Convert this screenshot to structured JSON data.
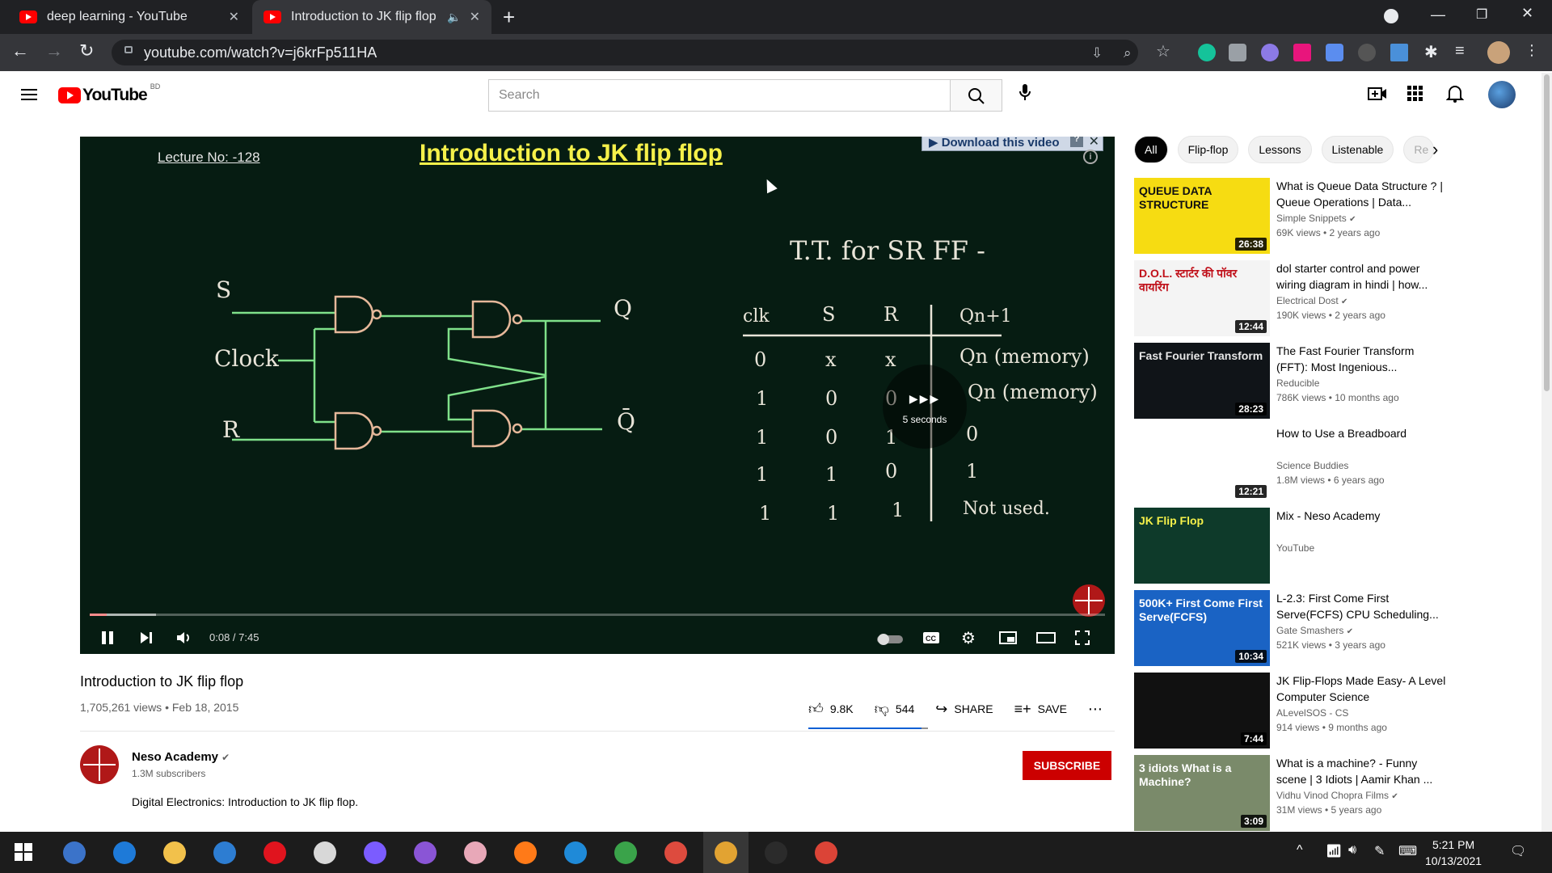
{
  "browser": {
    "tabs": [
      {
        "title": "deep learning - YouTube",
        "active": false
      },
      {
        "title": "Introduction to JK flip flop - Y",
        "active": true
      }
    ],
    "new_tab_symbol": "+",
    "url": "youtube.com/watch?v=j6krFp511HA"
  },
  "youtube": {
    "logo_text": "YouTube",
    "country_code": "BD",
    "search_placeholder": "Search"
  },
  "player": {
    "lecture_label": "Lecture No: -128",
    "slide_title": "Introduction to JK flip flop",
    "download_banner": "Download this video",
    "download_help": "?",
    "circuit_labels": {
      "s": "S",
      "clock": "Clock",
      "r": "R",
      "q": "Q",
      "qbar": "Q̄"
    },
    "truth_table_title": "T.T. for SR FF -",
    "truth_table": {
      "headers": [
        "clk",
        "S",
        "R",
        "Qn+1"
      ],
      "rows": [
        [
          "0",
          "x",
          "x",
          "Qn (memory)"
        ],
        [
          "1",
          "0",
          "0",
          "Qn (memory)"
        ],
        [
          "1",
          "0",
          "1",
          "0"
        ],
        [
          "1",
          "1",
          "0",
          "1"
        ],
        [
          "1",
          "1",
          "1",
          "Not used."
        ]
      ]
    },
    "skip_label": "5 seconds",
    "time": "0:08 / 7:45",
    "progress": 0.017
  },
  "video": {
    "title": "Introduction to JK flip flop",
    "views_date": "1,705,261 views • Feb 18, 2015",
    "likes": "9.8K",
    "dislikes": "544",
    "like_ratio": 0.947,
    "share": "SHARE",
    "save": "SAVE",
    "channel": "Neso Academy",
    "subscribers": "1.3M subscribers",
    "subscribe": "SUBSCRIBE",
    "description": "Digital Electronics: Introduction to JK flip flop."
  },
  "sidebar": {
    "chips": [
      "All",
      "Flip-flop",
      "Lessons",
      "Listenable",
      "Re"
    ],
    "recs": [
      {
        "title": "What is Queue Data Structure ? | Queue Operations | Data...",
        "channel": "Simple Snippets",
        "verified": true,
        "meta": "69K views • 2 years ago",
        "duration": "26:38",
        "thumb_text": "QUEUE DATA STRUCTURE",
        "thumb_bg": "#f6dc12",
        "thumb_fg": "#111111"
      },
      {
        "title": "dol starter control and power wiring diagram in hindi | how...",
        "channel": "Electrical Dost",
        "verified": true,
        "meta": "190K views • 2 years ago",
        "duration": "12:44",
        "thumb_text": "D.O.L. स्टार्टर की पॉवर वायरिंग",
        "thumb_bg": "#f4f4f4",
        "thumb_fg": "#c0101a"
      },
      {
        "title": "The Fast Fourier Transform (FFT): Most Ingenious...",
        "channel": "Reducible",
        "verified": false,
        "meta": "786K views • 10 months ago",
        "duration": "28:23",
        "thumb_text": "Fast Fourier Transform",
        "thumb_bg": "#101418",
        "thumb_fg": "#e6e6e6"
      },
      {
        "title": "How to Use a Breadboard",
        "channel": "Science Buddies",
        "verified": false,
        "meta": "1.8M views • 6 years ago",
        "duration": "12:21",
        "thumb_text": "",
        "thumb_bg": "#ffffff",
        "thumb_fg": "#333333"
      },
      {
        "title": "Mix - Neso Academy",
        "channel": "YouTube",
        "verified": false,
        "meta": "",
        "duration": "",
        "thumb_text": "JK Flip Flop",
        "thumb_bg": "#0e3a2a",
        "thumb_fg": "#f5f04a"
      },
      {
        "title": "L-2.3: First Come First Serve(FCFS) CPU Scheduling...",
        "channel": "Gate Smashers",
        "verified": true,
        "meta": "521K views • 3 years ago",
        "duration": "10:34",
        "thumb_text": "500K+ First Come First Serve(FCFS)",
        "thumb_bg": "#1a63c4",
        "thumb_fg": "#ffffff"
      },
      {
        "title": "JK Flip-Flops Made Easy- A Level Computer Science",
        "channel": "ALevelSOS - CS",
        "verified": false,
        "meta": "914 views • 9 months ago",
        "duration": "7:44",
        "thumb_text": "",
        "thumb_bg": "#111111",
        "thumb_fg": "#dddddd"
      },
      {
        "title": "What is a machine? - Funny scene | 3 Idiots | Aamir Khan ...",
        "channel": "Vidhu Vinod Chopra Films",
        "verified": true,
        "meta": "31M views • 5 years ago",
        "duration": "3:09",
        "thumb_text": "3 idiots What is a Machine?",
        "thumb_bg": "#7a8a6a",
        "thumb_fg": "#ffffff"
      }
    ]
  },
  "taskbar": {
    "time": "5:21 PM",
    "date": "10/13/2021",
    "apps": [
      {
        "name": "qbittorrent",
        "color": "#3b73c9"
      },
      {
        "name": "edge-legacy",
        "color": "#1e7ad8"
      },
      {
        "name": "file-explorer",
        "color": "#f2c14b"
      },
      {
        "name": "mail",
        "color": "#2d7dd2"
      },
      {
        "name": "opera",
        "color": "#e0141e"
      },
      {
        "name": "inkscape",
        "color": "#d8d8d8"
      },
      {
        "name": "messenger",
        "color": "#7b5cff"
      },
      {
        "name": "github-desktop",
        "color": "#8a55d6"
      },
      {
        "name": "paint",
        "color": "#e8a8b8"
      },
      {
        "name": "firefox",
        "color": "#ff7a18"
      },
      {
        "name": "vscode",
        "color": "#1f8ad8"
      },
      {
        "name": "app-globe",
        "color": "#3aa34a"
      },
      {
        "name": "chrome",
        "color": "#dd4b3e"
      },
      {
        "name": "chrome-active",
        "color": "#e2a332"
      },
      {
        "name": "terminal",
        "color": "#2b2b2b"
      },
      {
        "name": "chrome-dev",
        "color": "#db4437"
      }
    ]
  }
}
